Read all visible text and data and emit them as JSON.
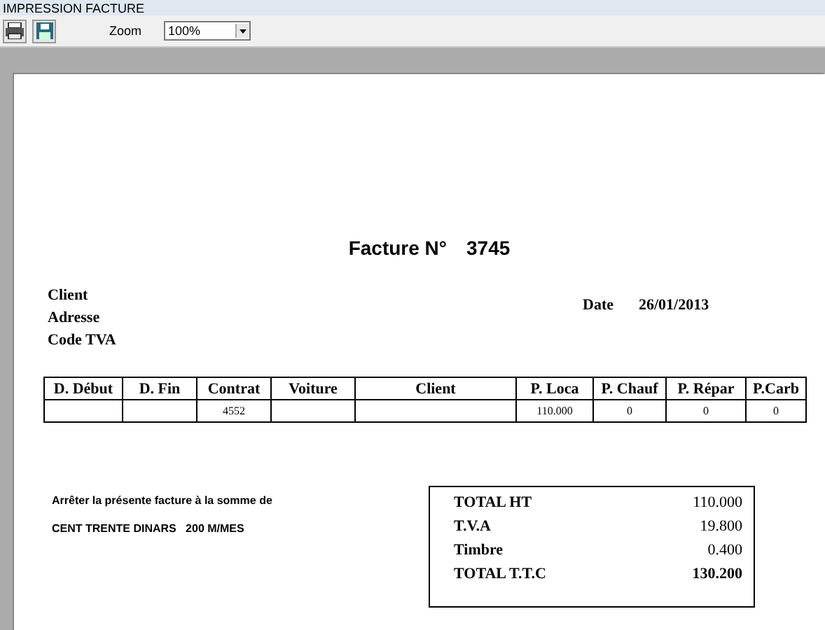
{
  "window": {
    "title": "IMPRESSION FACTURE"
  },
  "toolbar": {
    "zoom_label": "Zoom",
    "zoom_value": "100%"
  },
  "invoice": {
    "title_label": "Facture N°",
    "number": "3745",
    "client_fields": [
      "Client",
      "Adresse",
      "Code TVA"
    ],
    "date_label": "Date",
    "date": "26/01/2013",
    "table": {
      "columns": [
        "D. Début",
        "D. Fin",
        "Contrat",
        "Voiture",
        "Client",
        "P. Loca",
        "P. Chauf",
        "P. Répar",
        "P.Carb"
      ],
      "rows": [
        [
          "",
          "",
          "4552",
          "",
          "",
          "110.000",
          "0",
          "0",
          "0"
        ]
      ]
    },
    "amount_intro": "Arrêter la présente facture à la somme de",
    "amount_words": "CENT TRENTE DINARS   200 M/MES",
    "totals": [
      {
        "label": "TOTAL HT",
        "value": "110.000",
        "bold": false
      },
      {
        "label": "T.V.A",
        "value": "19.800",
        "bold": false
      },
      {
        "label": "Timbre",
        "value": "0.400",
        "bold": false
      },
      {
        "label": "TOTAL T.T.C",
        "value": "130.200",
        "bold": true
      }
    ]
  }
}
